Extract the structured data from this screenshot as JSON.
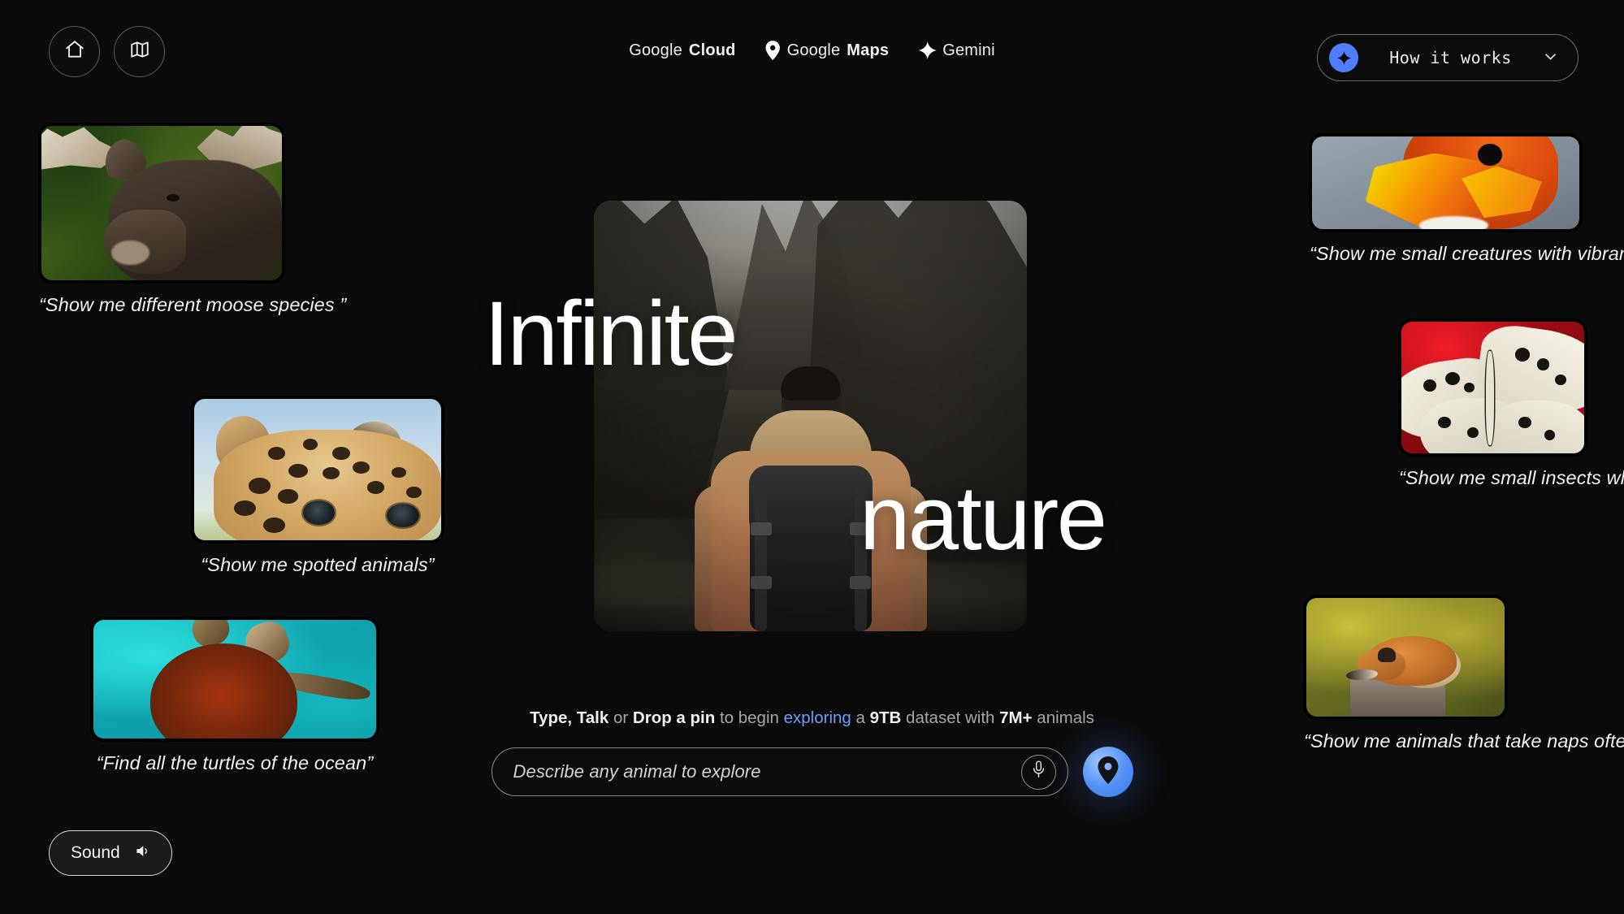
{
  "topbar": {
    "home_icon": "home-icon",
    "map_icon": "map-icon",
    "brands": [
      {
        "name_prefix": "Google",
        "name_suffix": "Cloud",
        "icon": ""
      },
      {
        "name_prefix": "Google",
        "name_suffix": "Maps",
        "icon": "location-pin-icon"
      },
      {
        "name_prefix": "",
        "name_suffix": "Gemini",
        "icon": "sparkle-icon"
      }
    ],
    "how_it_works": {
      "label": "How it works",
      "spark_icon": "sparkle-icon",
      "chevron": "⌄",
      "accent": "#4f7dfb"
    }
  },
  "hero": {
    "word_one": "Infinite",
    "word_two": "nature",
    "image_alt": "hiker-with-backpack-facing-mountain"
  },
  "cards": [
    {
      "caption": "“Show me different moose species ”",
      "image_alt": "moose-portrait"
    },
    {
      "caption": "“Show me spotted animals”",
      "image_alt": "leopard-face"
    },
    {
      "caption": "“Find all the turtles of the ocean”",
      "image_alt": "sea-turtle-swimming"
    },
    {
      "caption": "“Show me small creatures with vibrant colors”",
      "image_alt": "orange-hummingbird"
    },
    {
      "caption": "“Show me small insects who love flowers”",
      "image_alt": "paper-kite-butterfly-on-red-flowers"
    },
    {
      "caption": "“Show me animals that take naps often”",
      "image_alt": "sleeping-fox-on-stump"
    }
  ],
  "prompt": {
    "part1": "Type, Talk",
    "part2": " or ",
    "part3": "Drop a pin",
    "part4": " to begin ",
    "link": "exploring",
    "part5": " a ",
    "size": "9TB",
    "part6": " dataset with ",
    "count": "7M+",
    "part7": " animals",
    "link_color": "#6d9dfb"
  },
  "search": {
    "placeholder": "Describe any animal to explore",
    "value": "",
    "mic_icon": "microphone-icon",
    "pin_icon": "location-pin-icon",
    "pin_color": "#4f8ff5"
  },
  "sound": {
    "label": "Sound",
    "icon": "speaker-icon"
  }
}
